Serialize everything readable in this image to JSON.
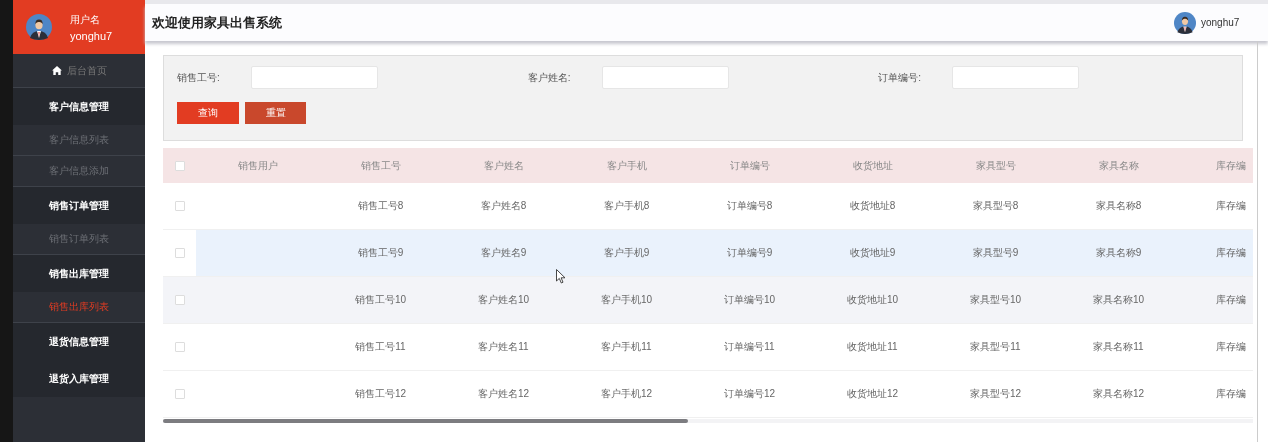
{
  "sidebar": {
    "user_label": "用户名",
    "user_name": "yonghu7",
    "home": {
      "label": "后台首页"
    },
    "groups": [
      {
        "label": "客户信息管理",
        "children": [
          {
            "label": "客户信息列表",
            "selected": false
          },
          {
            "label": "客户信息添加",
            "selected": false
          }
        ]
      },
      {
        "label": "销售订单管理",
        "children": [
          {
            "label": "销售订单列表",
            "selected": false
          }
        ]
      },
      {
        "label": "销售出库管理",
        "children": [
          {
            "label": "销售出库列表",
            "selected": true
          }
        ]
      },
      {
        "label": "退货信息管理"
      },
      {
        "label": "退货入库管理"
      }
    ]
  },
  "header": {
    "title": "欢迎使用家具出售系统",
    "user_name": "yonghu7"
  },
  "search": {
    "fields": [
      {
        "label": "销售工号:"
      },
      {
        "label": "客户姓名:"
      },
      {
        "label": "订单编号:"
      }
    ],
    "buttons": [
      {
        "label": "查询",
        "kind": "primary"
      },
      {
        "label": "重置",
        "kind": "reset"
      }
    ]
  },
  "table": {
    "header_checked": false,
    "columns": [
      "销售用户",
      "销售工号",
      "客户姓名",
      "客户手机",
      "订单编号",
      "收货地址",
      "家具型号",
      "家具名称",
      "库存编"
    ],
    "rows": [
      {
        "checked": false,
        "kind": "plain",
        "cells": [
          "",
          "销售工号8",
          "客户姓名8",
          "客户手机8",
          "订单编号8",
          "收货地址8",
          "家具型号8",
          "家具名称8",
          "库存编"
        ]
      },
      {
        "checked": false,
        "kind": "hover",
        "cells": [
          "",
          "销售工号9",
          "客户姓名9",
          "客户手机9",
          "订单编号9",
          "收货地址9",
          "家具型号9",
          "家具名称9",
          "库存编"
        ]
      },
      {
        "checked": false,
        "kind": "stripe",
        "cells": [
          "",
          "销售工号10",
          "客户姓名10",
          "客户手机10",
          "订单编号10",
          "收货地址10",
          "家具型号10",
          "家具名称10",
          "库存编"
        ]
      },
      {
        "checked": false,
        "kind": "plain",
        "cells": [
          "",
          "销售工号11",
          "客户姓名11",
          "客户手机11",
          "订单编号11",
          "收货地址11",
          "家具型号11",
          "家具名称11",
          "库存编"
        ]
      },
      {
        "checked": false,
        "kind": "plain",
        "cells": [
          "",
          "销售工号12",
          "客户姓名12",
          "客户手机12",
          "订单编号12",
          "收货地址12",
          "家具型号12",
          "家具名称12",
          "库存编"
        ]
      }
    ]
  }
}
